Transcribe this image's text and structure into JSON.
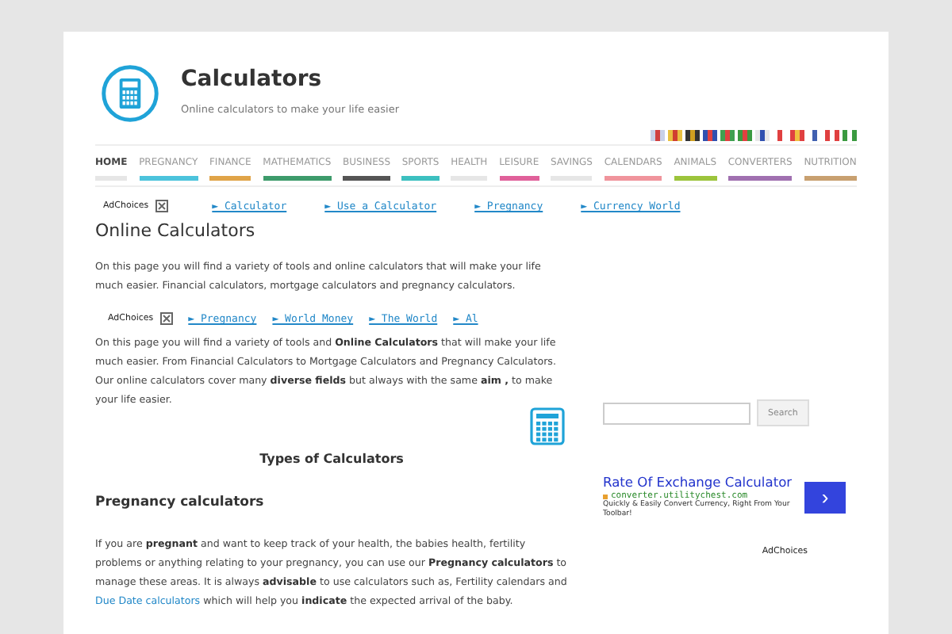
{
  "header": {
    "title": "Calculators",
    "tagline": "Online calculators to make your life easier"
  },
  "nav": [
    {
      "label": "HOME",
      "selected": true,
      "color": "#e6e6e6"
    },
    {
      "label": "PREGNANCY",
      "selected": false,
      "color": "#4cc3dc"
    },
    {
      "label": "FINANCE",
      "selected": false,
      "color": "#e0a448"
    },
    {
      "label": "MATHEMATICS",
      "selected": false,
      "color": "#3d9b6b"
    },
    {
      "label": "BUSINESS",
      "selected": false,
      "color": "#555555"
    },
    {
      "label": "SPORTS",
      "selected": false,
      "color": "#3cc0c0"
    },
    {
      "label": "HEALTH",
      "selected": false,
      "color": "#e6e6e6"
    },
    {
      "label": "LEISURE",
      "selected": false,
      "color": "#e0609a"
    },
    {
      "label": "SAVINGS",
      "selected": false,
      "color": "#e6e6e6"
    },
    {
      "label": "CALENDARS",
      "selected": false,
      "color": "#f0949c"
    },
    {
      "label": "ANIMALS",
      "selected": false,
      "color": "#9cc43c"
    },
    {
      "label": "CONVERTERS",
      "selected": false,
      "color": "#a070b0"
    },
    {
      "label": "NUTRITION",
      "selected": false,
      "color": "#c8a070"
    }
  ],
  "ad_bar_1": {
    "label": "AdChoices",
    "links": [
      "► Calculator",
      "► Use a Calculator",
      "► Pregnancy",
      "► Currency World"
    ]
  },
  "heading": "Online Calculators",
  "intro": "On this page you will find a variety of tools and online calculators that will make your life much easier. Financial calculators, mortgage calculators and pregnancy calculators.",
  "ad_bar_2": {
    "label": "AdChoices",
    "links": [
      "► Pregnancy",
      "► World Money",
      "► The World",
      "► Al"
    ]
  },
  "paragraph_2": "On this page you will find a variety of tools and **Online Calculators** that will make your life much easier. From Financial Calculators to Mortgage Calculators and Pregnancy Calculators. Our online calculators cover many **diverse fields** but always with the same **aim ,** to make your life easier.",
  "section_title": "Types of Calculators",
  "subheading": "Pregnancy calculators",
  "paragraph_3": [
    {
      "kind": "text",
      "text": "If you are **pregnant** and want to keep track of your health, the babies health, fertility problems or anything relating to your pregnancy, you can use our **Pregnancy calculators** to manage these areas. It is always **advisable** to use calculators such as, Fertility calendars and "
    },
    {
      "kind": "link",
      "text": "Due Date calculators"
    },
    {
      "kind": "text",
      "text": " which will help you **indicate** the expected arrival of the baby."
    }
  ],
  "sidebar": {
    "search_button": "Search",
    "ad": {
      "title": "Rate Of Exchange Calculator",
      "url": "converter.utilitychest.com",
      "description": "Quickly & Easily Convert Currency, Right From Your Toolbar!",
      "button": "›",
      "adchoices": "AdChoices"
    }
  }
}
